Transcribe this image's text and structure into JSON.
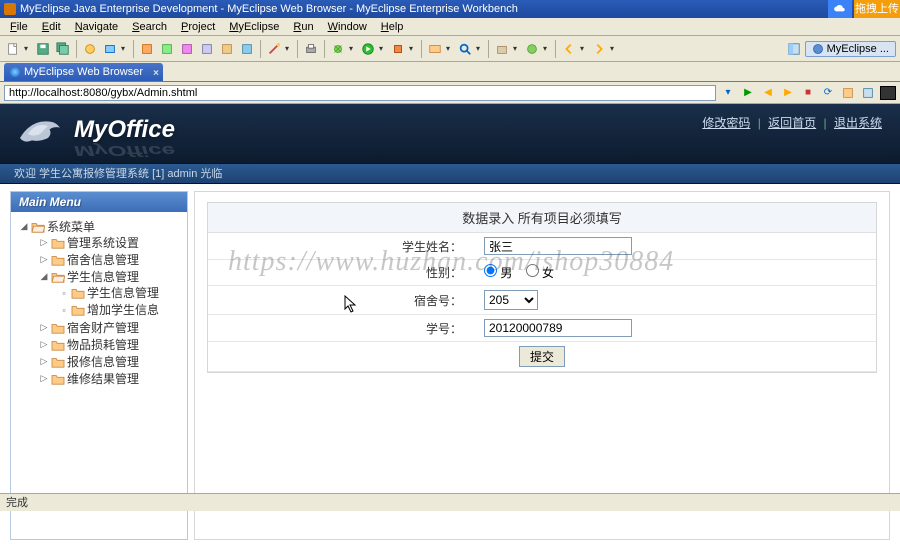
{
  "window": {
    "title": "MyEclipse Java Enterprise Development - MyEclipse Web Browser - MyEclipse Enterprise Workbench",
    "upload_label": "拖拽上传"
  },
  "menubar": [
    "File",
    "Edit",
    "Navigate",
    "Search",
    "Project",
    "MyEclipse",
    "Run",
    "Window",
    "Help"
  ],
  "perspective": "MyEclipse ...",
  "tab": {
    "title": "MyEclipse Web Browser"
  },
  "address": "http://localhost:8080/gybx/Admin.shtml",
  "header": {
    "brand": "MyOffice",
    "links": {
      "pw": "修改密码",
      "home": "返回首页",
      "exit": "退出系统"
    }
  },
  "welcome": "欢迎 学生公寓报修管理系统 [1] admin 光临",
  "sidebar": {
    "title": "Main Menu",
    "root": "系统菜单",
    "items": [
      {
        "label": "管理系统设置"
      },
      {
        "label": "宿舍信息管理"
      },
      {
        "label": "学生信息管理",
        "expanded": true,
        "children": [
          {
            "label": "学生信息管理"
          },
          {
            "label": "增加学生信息"
          }
        ]
      },
      {
        "label": "宿舍财产管理"
      },
      {
        "label": "物品损耗管理"
      },
      {
        "label": "报修信息管理"
      },
      {
        "label": "维修结果管理"
      }
    ]
  },
  "form": {
    "heading": "数据录入 所有项目必须填写",
    "labels": {
      "name": "学生姓名：",
      "gender": "性别：",
      "dorm": "宿舍号：",
      "sid": "学号："
    },
    "gender_options": {
      "male": "男",
      "female": "女"
    },
    "values": {
      "name": "张三",
      "dorm": "205",
      "sid": "20120000789"
    },
    "submit": "提交"
  },
  "watermark": "https://www.huzhan.com/ishop30884",
  "status": "完成"
}
